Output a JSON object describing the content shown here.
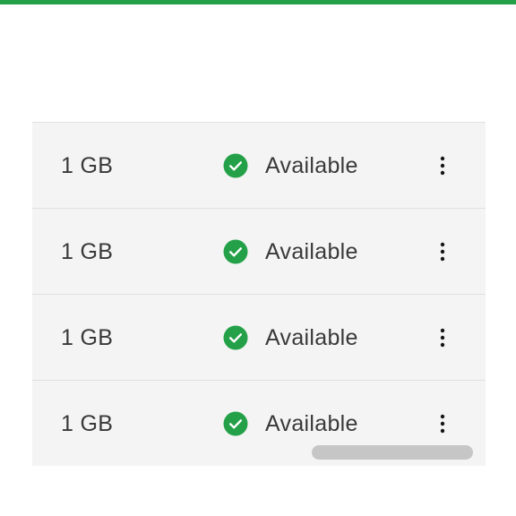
{
  "theme": {
    "accent": "#24a148",
    "row_background": "#f4f4f4",
    "divider": "#e0e0e0",
    "text": "#393939",
    "status_success": "#24a148"
  },
  "table": {
    "rows": [
      {
        "size": "1 GB",
        "status": "Available",
        "status_icon": "checkmark-filled-icon",
        "action_icon": "overflow-menu-vertical-icon"
      },
      {
        "size": "1 GB",
        "status": "Available",
        "status_icon": "checkmark-filled-icon",
        "action_icon": "overflow-menu-vertical-icon"
      },
      {
        "size": "1 GB",
        "status": "Available",
        "status_icon": "checkmark-filled-icon",
        "action_icon": "overflow-menu-vertical-icon"
      },
      {
        "size": "1 GB",
        "status": "Available",
        "status_icon": "checkmark-filled-icon",
        "action_icon": "overflow-menu-vertical-icon"
      }
    ]
  }
}
